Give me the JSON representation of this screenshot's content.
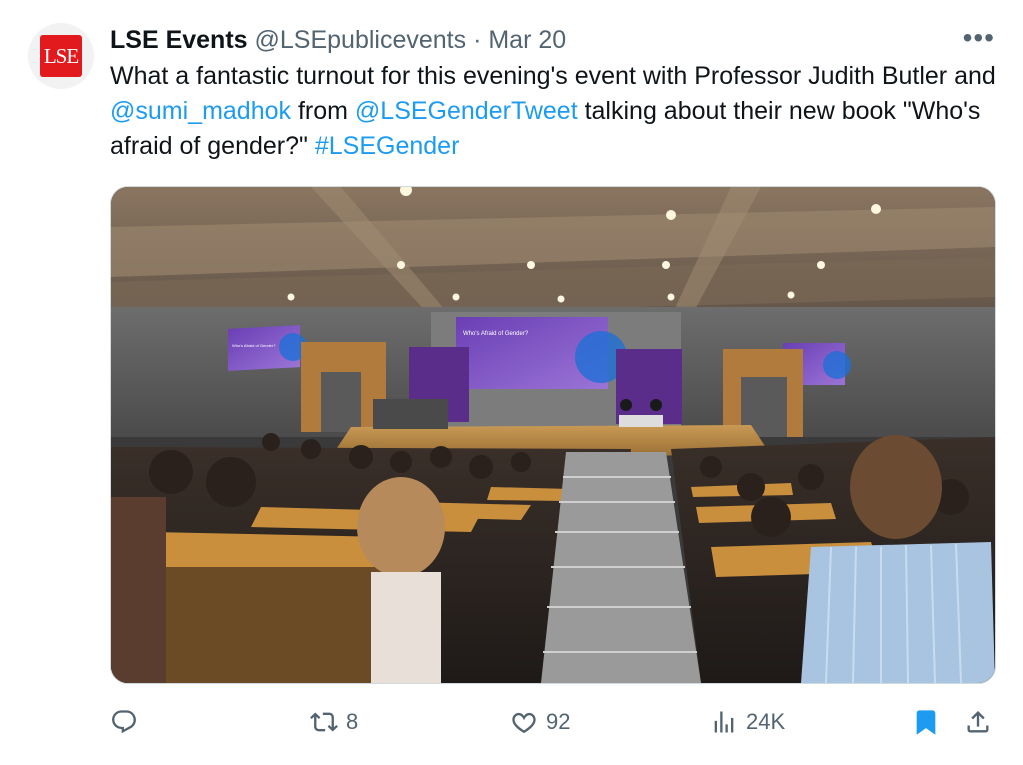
{
  "tweet": {
    "display_name": "LSE Events",
    "handle": "@LSEpublicevents",
    "separator": "·",
    "date": "Mar 20",
    "more_label": "•••",
    "avatar_text": "LSE",
    "text_segments": {
      "t1": "What a fantastic turnout for this evening's event with Professor Judith Butler and ",
      "m1": "@sumi_madhok",
      "t2": " from ",
      "m2": "@LSEGenderTweet",
      "t3": " talking about their new book \"Who's afraid of gender?\" ",
      "h1": "#LSEGender"
    },
    "media": {
      "screen_main_title": "Who's Afraid of Gender?",
      "screen_side_title": "Who's Afraid of Gender?"
    },
    "actions": {
      "reply_count": "",
      "retweet_count": "8",
      "like_count": "92",
      "views_count": "24K"
    },
    "colors": {
      "link": "#1d9bf0",
      "muted": "#536471",
      "bookmark_active": "#1d9bf0",
      "brand_red": "#e2191d"
    },
    "icons": [
      "reply-icon",
      "retweet-icon",
      "like-icon",
      "views-icon",
      "bookmark-icon",
      "share-icon",
      "more-icon"
    ]
  }
}
